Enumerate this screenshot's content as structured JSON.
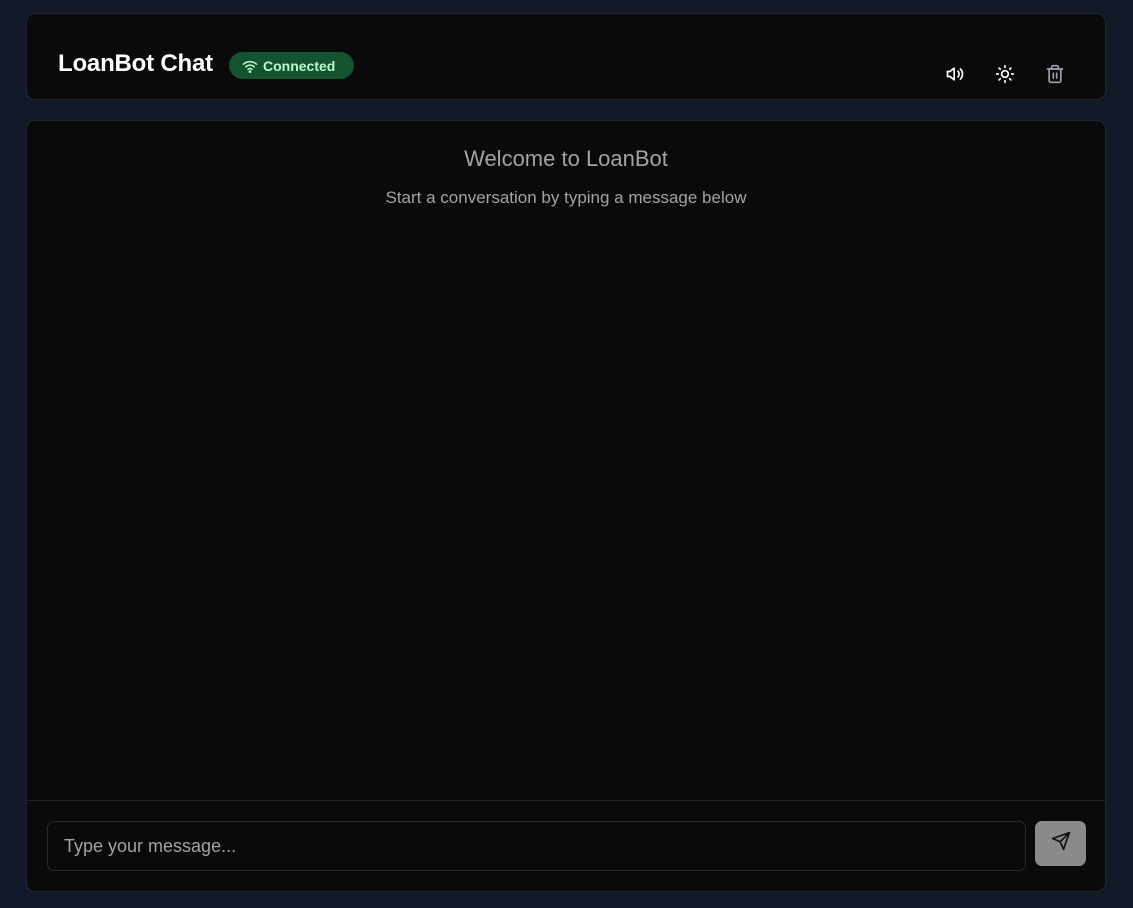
{
  "header": {
    "title": "LoanBot Chat",
    "status": {
      "label": "Connected",
      "icon": "wifi-icon",
      "color": "#14532d",
      "text_color": "#bbf7d0"
    },
    "actions": [
      {
        "name": "sound-toggle",
        "icon": "volume-icon"
      },
      {
        "name": "theme-toggle",
        "icon": "sun-icon"
      },
      {
        "name": "clear-chat",
        "icon": "trash-icon"
      }
    ]
  },
  "chat": {
    "welcome_title": "Welcome to LoanBot",
    "welcome_subtitle": "Start a conversation by typing a message below",
    "messages": []
  },
  "composer": {
    "placeholder": "Type your message...",
    "value": "",
    "send_icon": "send-icon"
  },
  "colors": {
    "page_bg": "#111827",
    "panel_bg": "#0a0a0a",
    "send_button_bg": "#8a8a8a"
  }
}
